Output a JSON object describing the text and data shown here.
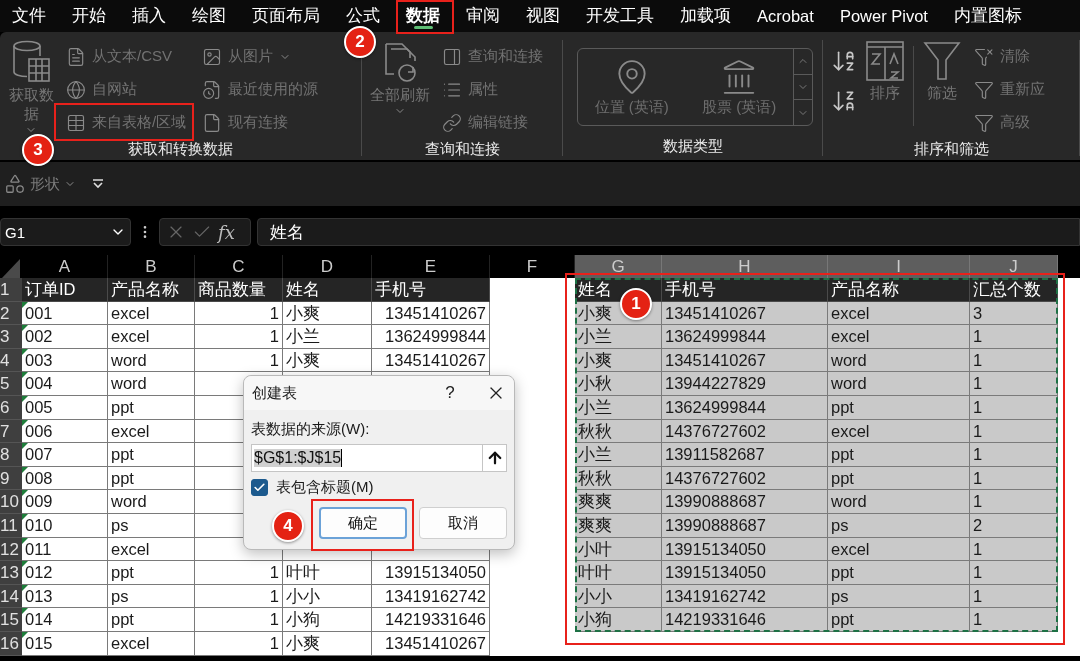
{
  "menu_tabs": [
    {
      "label": "文件",
      "selected": false
    },
    {
      "label": "开始",
      "selected": false
    },
    {
      "label": "插入",
      "selected": false
    },
    {
      "label": "绘图",
      "selected": false
    },
    {
      "label": "页面布局",
      "selected": false
    },
    {
      "label": "公式",
      "selected": false
    },
    {
      "label": "数据",
      "selected": true,
      "annotation": "2"
    },
    {
      "label": "审阅",
      "selected": false
    },
    {
      "label": "视图",
      "selected": false
    },
    {
      "label": "开发工具",
      "selected": false
    },
    {
      "label": "加载项",
      "selected": false
    },
    {
      "label": "Acrobat",
      "selected": false
    },
    {
      "label": "Power Pivot",
      "selected": false
    },
    {
      "label": "内置图标",
      "selected": false
    }
  ],
  "ribbon": {
    "groups": [
      {
        "kind": "commands",
        "label": "获取和转换数据",
        "large": [
          {
            "label": "获取数据",
            "disabled": true
          }
        ],
        "columns": [
          [
            {
              "label": "从文本/CSV",
              "disabled": true
            },
            {
              "label": "自网站",
              "disabled": true
            },
            {
              "label": "来自表格/区域",
              "disabled": true,
              "annotation": "3"
            }
          ],
          [
            {
              "label": "从图片",
              "disabled": true
            },
            {
              "label": "最近使用的源",
              "disabled": true
            },
            {
              "label": "现有连接",
              "disabled": true
            }
          ]
        ]
      },
      {
        "kind": "commands",
        "label": "查询和连接",
        "large": [
          {
            "label": "全部刷新",
            "disabled": true
          }
        ],
        "columns": [
          [
            {
              "label": "查询和连接",
              "disabled": true
            },
            {
              "label": "属性",
              "disabled": true
            },
            {
              "label": "编辑链接",
              "disabled": true
            }
          ]
        ]
      },
      {
        "kind": "gallery",
        "label": "数据类型",
        "items": [
          {
            "label": "位置 (英语)",
            "disabled": true
          },
          {
            "label": "股票 (英语)",
            "disabled": true
          }
        ]
      },
      {
        "kind": "sort-filter",
        "label": "排序和筛选",
        "large": [
          {
            "label": "排序",
            "disabled": true
          },
          {
            "label": "筛选",
            "disabled": true
          }
        ],
        "columns": [
          [
            {
              "label": "清除",
              "disabled": true
            },
            {
              "label": "重新应",
              "disabled": true
            },
            {
              "label": "高级",
              "disabled": true
            }
          ]
        ]
      }
    ]
  },
  "quick_bar": {
    "items": [
      {
        "label": "形状",
        "disabled": true
      }
    ]
  },
  "formula_bar": {
    "name_box": "G1",
    "function_symbol": "fx",
    "value": "姓名"
  },
  "sheet": {
    "columns": [
      {
        "label": "A",
        "selected": false
      },
      {
        "label": "B",
        "selected": false
      },
      {
        "label": "C",
        "selected": false
      },
      {
        "label": "D",
        "selected": false
      },
      {
        "label": "E",
        "selected": false
      },
      {
        "label": "F",
        "selected": false
      },
      {
        "label": "G",
        "selected": true
      },
      {
        "label": "H",
        "selected": true
      },
      {
        "label": "I",
        "selected": true
      },
      {
        "label": "J",
        "selected": true
      }
    ],
    "row_numbers": [
      "1",
      "2",
      "3",
      "4",
      "5",
      "6",
      "7",
      "8",
      "9",
      "10",
      "11",
      "12",
      "13",
      "14",
      "15",
      "16"
    ],
    "left_table": {
      "header": [
        "订单ID",
        "产品名称",
        "商品数量",
        "姓名",
        "手机号"
      ],
      "rows": [
        {
          "order_id": "001",
          "product": "excel",
          "quantity": "1",
          "name": "小爽",
          "phone": "13451410267"
        },
        {
          "order_id": "002",
          "product": "excel",
          "quantity": "1",
          "name": "小兰",
          "phone": "13624999844"
        },
        {
          "order_id": "003",
          "product": "word",
          "quantity": "1",
          "name": "小爽",
          "phone": "13451410267"
        },
        {
          "order_id": "004",
          "product": "word"
        },
        {
          "order_id": "005",
          "product": "ppt"
        },
        {
          "order_id": "006",
          "product": "excel"
        },
        {
          "order_id": "007",
          "product": "ppt"
        },
        {
          "order_id": "008",
          "product": "ppt"
        },
        {
          "order_id": "009",
          "product": "word"
        },
        {
          "order_id": "010",
          "product": "ps"
        },
        {
          "order_id": "011",
          "product": "excel"
        },
        {
          "order_id": "012",
          "product": "ppt",
          "quantity": "1",
          "name": "叶叶",
          "phone": "13915134050"
        },
        {
          "order_id": "013",
          "product": "ps",
          "quantity": "1",
          "name": "小小",
          "phone": "13419162742"
        },
        {
          "order_id": "014",
          "product": "ppt",
          "quantity": "1",
          "name": "小狗",
          "phone": "14219331646"
        },
        {
          "order_id": "015",
          "product": "excel",
          "quantity": "1",
          "name": "小爽",
          "phone": "13451410267"
        }
      ]
    },
    "right_table": {
      "selected": true,
      "annotation": "1",
      "header": [
        "姓名",
        "手机号",
        "产品名称",
        "汇总个数"
      ],
      "rows": [
        [
          "小爽",
          "13451410267",
          "excel",
          "3"
        ],
        [
          "小兰",
          "13624999844",
          "excel",
          "1"
        ],
        [
          "小爽",
          "13451410267",
          "word",
          "1"
        ],
        [
          "小秋",
          "13944227829",
          "word",
          "1"
        ],
        [
          "小兰",
          "13624999844",
          "ppt",
          "1"
        ],
        [
          "秋秋",
          "14376727602",
          "excel",
          "1"
        ],
        [
          "小兰",
          "13911582687",
          "ppt",
          "1"
        ],
        [
          "秋秋",
          "14376727602",
          "ppt",
          "1"
        ],
        [
          "爽爽",
          "13990888687",
          "word",
          "1"
        ],
        [
          "爽爽",
          "13990888687",
          "ps",
          "2"
        ],
        [
          "小叶",
          "13915134050",
          "excel",
          "1"
        ],
        [
          "叶叶",
          "13915134050",
          "ppt",
          "1"
        ],
        [
          "小小",
          "13419162742",
          "ps",
          "1"
        ],
        [
          "小狗",
          "14219331646",
          "ppt",
          "1"
        ]
      ]
    }
  },
  "dialog": {
    "title": "创建表",
    "help": "?",
    "source_label": "表数据的来源(W):",
    "source_value": "$G$1:$J$15",
    "has_headers": {
      "label": "表包含标题(M)",
      "checked": true
    },
    "buttons": [
      {
        "label": "确定",
        "default": true,
        "annotation": "4"
      },
      {
        "label": "取消",
        "default": false
      }
    ]
  }
}
